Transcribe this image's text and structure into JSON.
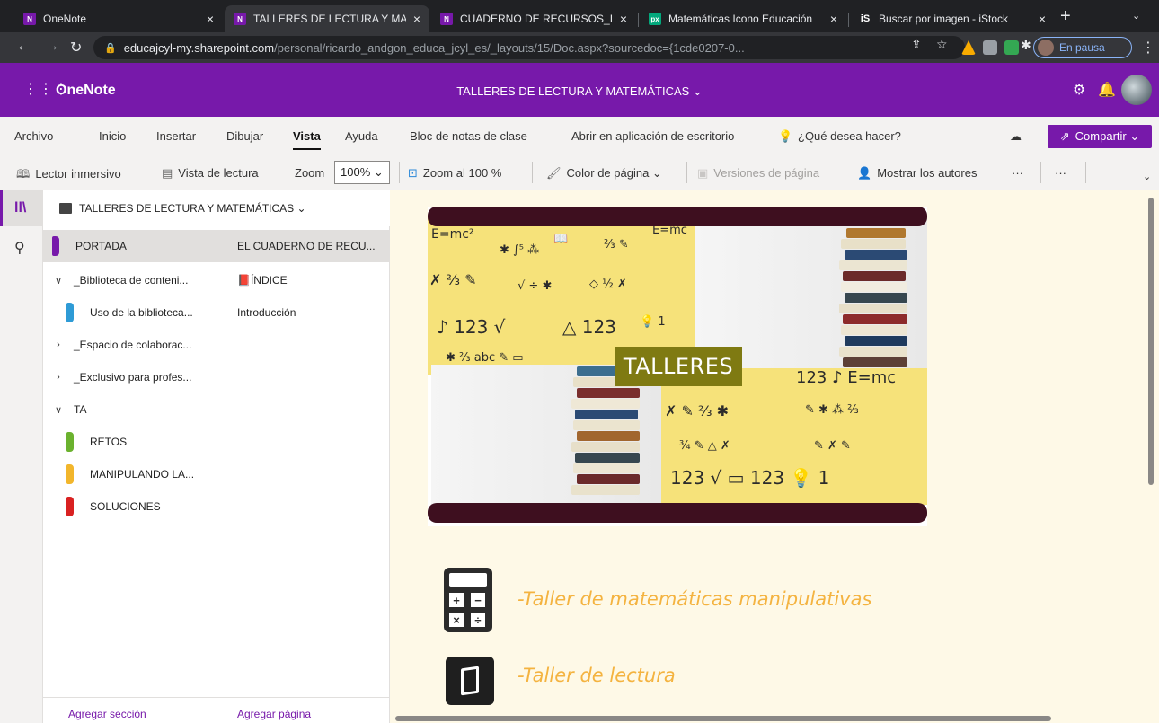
{
  "browser": {
    "tabs": [
      {
        "title": "OneNote",
        "active": false
      },
      {
        "title": "TALLERES DE LECTURA Y MA",
        "active": true
      },
      {
        "title": "CUADERNO DE RECURSOS_I",
        "active": false
      },
      {
        "title": "Matemáticas Icono Educación",
        "active": false
      },
      {
        "title": "Buscar por imagen - iStock",
        "active": false
      }
    ],
    "url_host": "educajcyl-my.sharepoint.com",
    "url_path": "/personal/ricardo_andgon_educa_jcyl_es/_layouts/15/Doc.aspx?sourcedoc={1cde0207-0...",
    "profile_label": "En pausa"
  },
  "app": {
    "name": "OneNote",
    "document_title": "TALLERES DE LECTURA Y MATEMÁTICAS ⌄"
  },
  "ribbon": {
    "menu": [
      "Archivo",
      "Inicio",
      "Insertar",
      "Dibujar",
      "Vista",
      "Ayuda",
      "Bloc de notas de clase",
      "Abrir en aplicación de escritorio"
    ],
    "active_menu": "Vista",
    "search_placeholder": "¿Qué desea hacer?",
    "share_label": "Compartir ⌄",
    "tools": {
      "immersive_reader": "Lector inmersivo",
      "reading_view": "Vista de lectura",
      "zoom_label": "Zoom",
      "zoom_value": "100% ⌄",
      "zoom_100": "Zoom al 100 %",
      "page_color": "Color de página ⌄",
      "page_versions": "Versiones de página",
      "show_authors": "Mostrar los autores",
      "more1": "···",
      "more2": "···"
    }
  },
  "notebook": {
    "title": "TALLERES DE LECTURA Y MATEMÁTICAS ⌄",
    "sections": [
      {
        "label": "PORTADA",
        "kind": "section",
        "color": "#7719aa",
        "selected": true
      },
      {
        "label": "_Biblioteca de conteni...",
        "kind": "group",
        "expanded": true
      },
      {
        "label": "Uso de la biblioteca...",
        "kind": "section",
        "color": "#2e9bd6",
        "selected": false
      },
      {
        "label": "_Espacio de colaborac...",
        "kind": "group",
        "expanded": false
      },
      {
        "label": "_Exclusivo para profes...",
        "kind": "group",
        "expanded": false
      },
      {
        "label": "TA",
        "kind": "group",
        "expanded": true
      },
      {
        "label": "RETOS",
        "kind": "section",
        "color": "#6bb22e",
        "selected": false
      },
      {
        "label": "MANIPULANDO LA...",
        "kind": "section",
        "color": "#f2b62c",
        "selected": false
      },
      {
        "label": "SOLUCIONES",
        "kind": "section",
        "color": "#d92121",
        "selected": false
      }
    ],
    "add_section": "Agregar sección"
  },
  "pages": {
    "items": [
      {
        "label": "EL CUADERNO DE RECU...",
        "selected": true
      },
      {
        "label": "📕ÍNDICE",
        "selected": false
      },
      {
        "label": "Introducción",
        "selected": false
      }
    ],
    "add_page": "Agregar página"
  },
  "canvas": {
    "banner_label": "TALLERES",
    "items": [
      {
        "icon": "calculator-icon",
        "text": "-Taller de matemáticas manipulativas"
      },
      {
        "icon": "book-icon",
        "text": "-Taller de lectura"
      }
    ],
    "item_color": "#f4b340",
    "background": "#fef9e7"
  }
}
